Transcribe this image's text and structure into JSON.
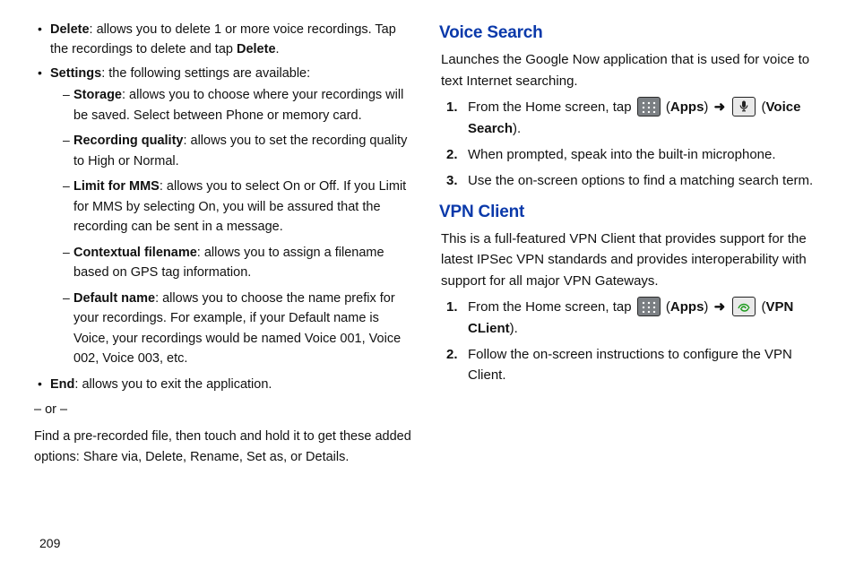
{
  "page_number": "209",
  "left": {
    "bullets": [
      {
        "label": "Delete",
        "text": ": allows you to delete 1 or more voice recordings. Tap the recordings to delete and tap ",
        "tail_bold": "Delete",
        "tail": "."
      },
      {
        "label": "Settings",
        "text": ": the following settings are available:",
        "sub": [
          {
            "label": "Storage",
            "text": ": allows you to choose where your recordings will be saved. Select between Phone or memory card."
          },
          {
            "label": "Recording quality",
            "text": ": allows you to set the recording quality to High or Normal."
          },
          {
            "label": "Limit for MMS",
            "text": ": allows you to select On or Off. If you Limit for MMS by selecting On, you will be assured that the recording can be sent in a message."
          },
          {
            "label": "Contextual filename",
            "text": ": allows you to assign a filename based on GPS tag information."
          },
          {
            "label": "Default name",
            "text": ": allows you to choose the name prefix for your recordings. For example, if your Default name is Voice, your recordings would be named Voice 001, Voice 002, Voice 003, etc."
          }
        ]
      },
      {
        "label": "End",
        "text": ": allows you to exit the application."
      }
    ],
    "or_divider": "– or –",
    "closing": "Find a pre-recorded file, then touch and hold it to get these added options: Share via, Delete, Rename, Set as, or Details."
  },
  "right": {
    "voice_search": {
      "title": "Voice Search",
      "intro": "Launches the Google Now application that is used for voice to text Internet searching.",
      "steps": [
        {
          "prefix": "From the Home screen, tap ",
          "apps_label": "Apps",
          "arrow": "➜",
          "app_name": "Voice Search"
        },
        {
          "text": "When prompted, speak into the built-in microphone."
        },
        {
          "text": "Use the on-screen options to find a matching search term."
        }
      ]
    },
    "vpn": {
      "title": "VPN Client",
      "intro": "This is a full-featured VPN Client that provides support for the latest IPSec VPN standards and provides interoperability with support for all major VPN Gateways.",
      "steps": [
        {
          "prefix": "From the Home screen, tap ",
          "apps_label": "Apps",
          "arrow": "➜",
          "app_name": "VPN CLient"
        },
        {
          "text": "Follow the on-screen instructions to configure the VPN Client."
        }
      ]
    }
  }
}
